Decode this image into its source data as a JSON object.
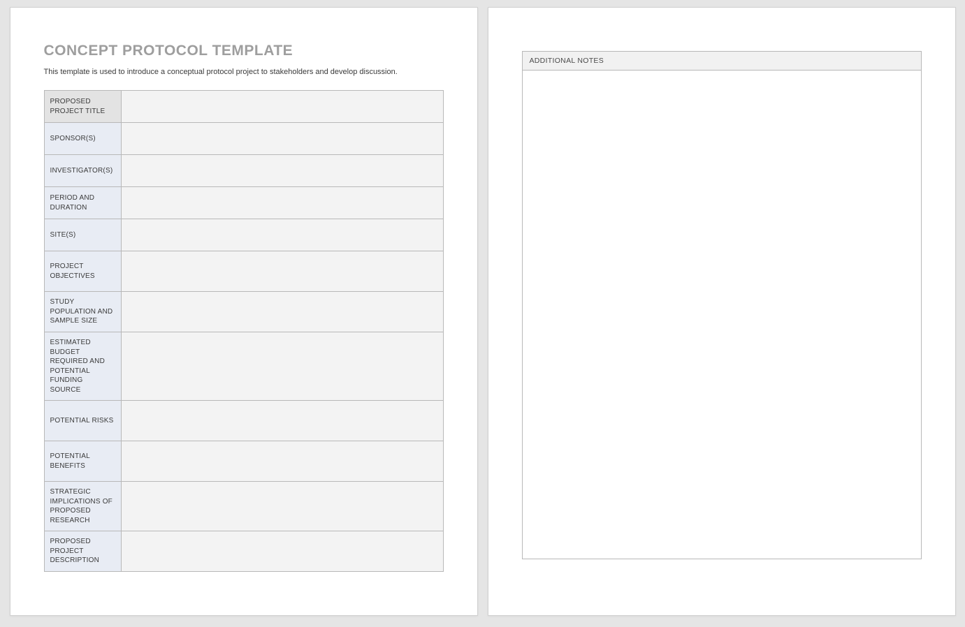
{
  "title": "CONCEPT PROTOCOL TEMPLATE",
  "subtitle": "This template is used to introduce a conceptual protocol project to stakeholders and develop discussion.",
  "fields": [
    {
      "label": "PROPOSED PROJECT TITLE",
      "value": ""
    },
    {
      "label": "SPONSOR(S)",
      "value": ""
    },
    {
      "label": "INVESTIGATOR(S)",
      "value": ""
    },
    {
      "label": "PERIOD AND DURATION",
      "value": ""
    },
    {
      "label": "SITE(S)",
      "value": ""
    },
    {
      "label": "PROJECT OBJECTIVES",
      "value": ""
    },
    {
      "label": "STUDY POPULATION AND SAMPLE SIZE",
      "value": ""
    },
    {
      "label": "ESTIMATED BUDGET REQUIRED AND POTENTIAL FUNDING SOURCE",
      "value": ""
    },
    {
      "label": "POTENTIAL RISKS",
      "value": ""
    },
    {
      "label": "POTENTIAL BENEFITS",
      "value": ""
    },
    {
      "label": "STRATEGIC IMPLICATIONS OF PROPOSED RESEARCH",
      "value": ""
    },
    {
      "label": "PROPOSED PROJECT DESCRIPTION",
      "value": ""
    }
  ],
  "notes": {
    "header": "ADDITIONAL NOTES",
    "body": ""
  }
}
